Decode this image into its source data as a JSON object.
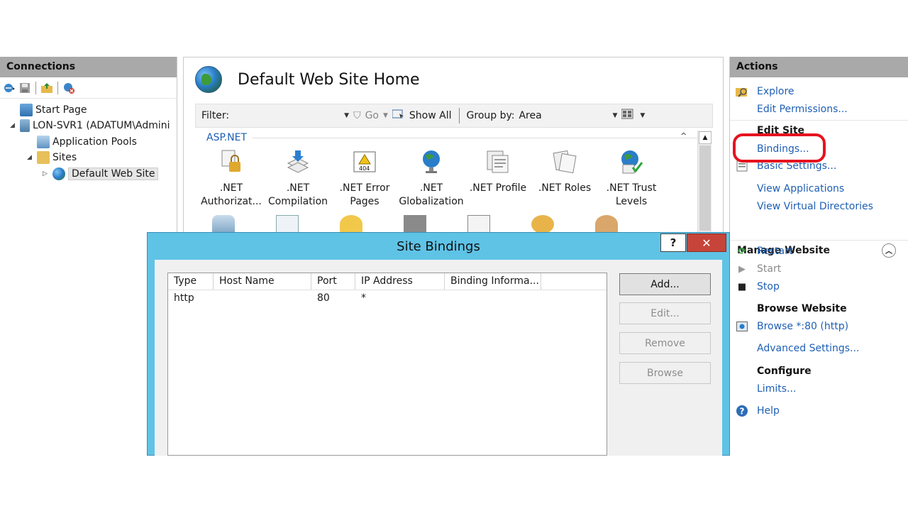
{
  "connections": {
    "header": "Connections",
    "tree": [
      {
        "label": "Start Page",
        "icon": "start-page-icon"
      },
      {
        "label": "LON-SVR1 (ADATUM\\Admini",
        "icon": "server-icon"
      },
      {
        "label": "Application Pools",
        "icon": "app-pools-icon"
      },
      {
        "label": "Sites",
        "icon": "sites-folder-icon"
      },
      {
        "label": "Default Web Site",
        "icon": "globe-icon"
      }
    ]
  },
  "main": {
    "title": "Default Web Site Home",
    "filter_label": "Filter:",
    "go_label": "Go",
    "show_all_label": "Show All",
    "group_by_label": "Group by:",
    "group_by_value": "Area",
    "section": "ASP.NET",
    "features": [
      {
        "label": ".NET Authorizat...",
        "icon": "dotnet-authorization-icon"
      },
      {
        "label": ".NET Compilation",
        "icon": "dotnet-compilation-icon"
      },
      {
        "label": ".NET Error Pages",
        "icon": "dotnet-error-pages-icon"
      },
      {
        "label": ".NET Globalization",
        "icon": "dotnet-globalization-icon"
      },
      {
        "label": ".NET Profile",
        "icon": "dotnet-profile-icon"
      },
      {
        "label": ".NET Roles",
        "icon": "dotnet-roles-icon"
      },
      {
        "label": ".NET Trust Levels",
        "icon": "dotnet-trust-levels-icon"
      }
    ]
  },
  "actions": {
    "header": "Actions",
    "explore": "Explore",
    "edit_permissions": "Edit Permissions...",
    "edit_site": "Edit Site",
    "bindings": "Bindings...",
    "basic_settings": "Basic Settings...",
    "view_applications": "View Applications",
    "view_virtual_directories": "View Virtual Directories",
    "manage_website": "Manage Website",
    "restart": "Restart",
    "start": "Start",
    "stop": "Stop",
    "browse_website": "Browse Website",
    "browse_80": "Browse *:80 (http)",
    "advanced_settings": "Advanced Settings...",
    "configure": "Configure",
    "limits": "Limits...",
    "help": "Help",
    "highlight_color": "#e6121f"
  },
  "dialog": {
    "title": "Site Bindings",
    "help_button": "?",
    "close_button": "✕",
    "columns": [
      "Type",
      "Host Name",
      "Port",
      "IP Address",
      "Binding Informa..."
    ],
    "rows": [
      {
        "type": "http",
        "host": "",
        "port": "80",
        "ip": "*",
        "binding": ""
      }
    ],
    "buttons": {
      "add": "Add...",
      "edit": "Edit...",
      "remove": "Remove",
      "browse": "Browse"
    },
    "title_bar_color": "#5fc3e6"
  }
}
